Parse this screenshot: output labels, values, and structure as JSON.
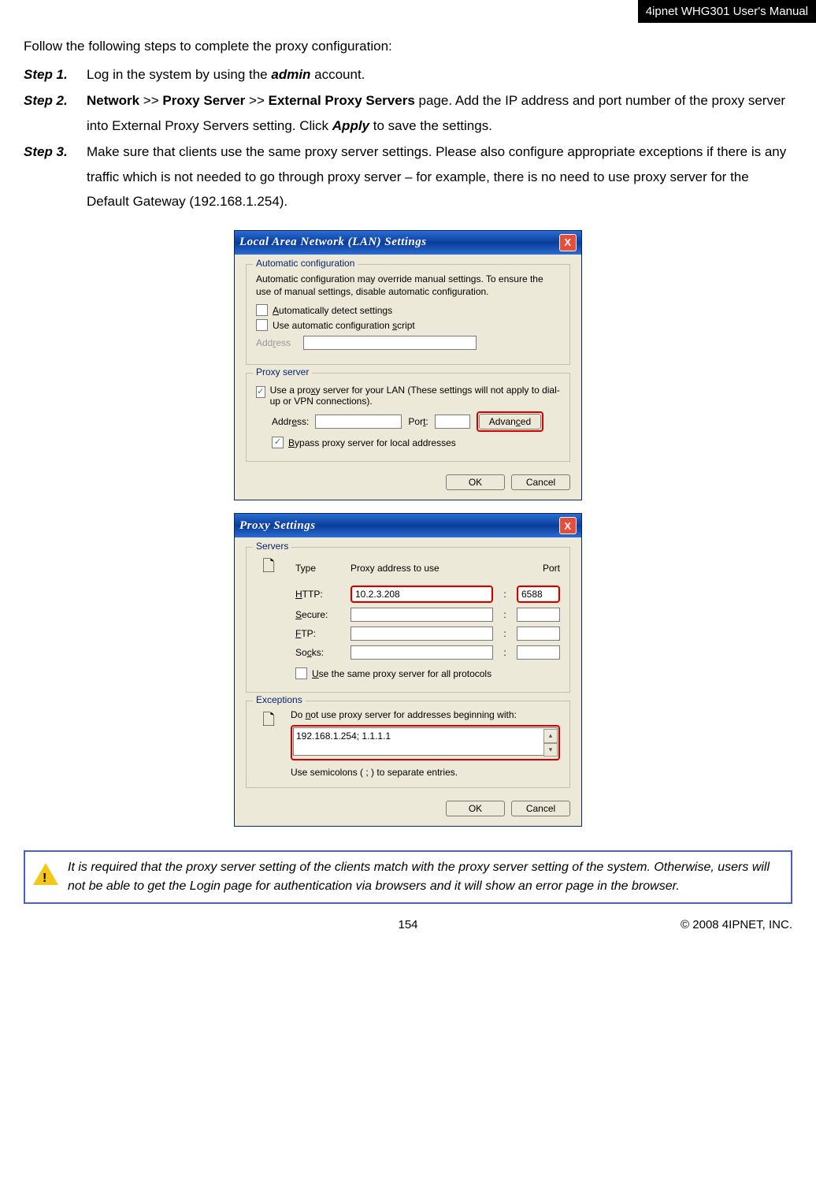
{
  "header": {
    "title": "4ipnet WHG301 User's Manual"
  },
  "intro": "Follow the following steps to complete the proxy configuration:",
  "steps": [
    {
      "label": "Step 1.",
      "pre": "Log in the system by using the ",
      "bold": "admin",
      "post": " account."
    },
    {
      "label": "Step 2.",
      "b1": "Network",
      "sep1": " >> ",
      "b2": "Proxy Server",
      "sep2": " >> ",
      "b3": "External Proxy Servers",
      "post1": " page. Add the IP address and port number of the proxy server into External Proxy Servers setting. Click ",
      "bapply": "Apply",
      "post2": " to save the settings."
    },
    {
      "label": "Step 3.",
      "text": "Make sure that clients use the same proxy server settings. Please also configure appropriate exceptions if there is any traffic which is not needed to go through proxy server – for example, there is no need to use proxy server for the Default Gateway (192.168.1.254)."
    }
  ],
  "dialog1": {
    "title": "Local Area Network (LAN) Settings",
    "auto_legend": "Automatic configuration",
    "auto_desc": "Automatic configuration may override manual settings.  To ensure the use of manual settings, disable automatic configuration.",
    "cb_auto_detect_pre": "A",
    "cb_auto_detect_post": "utomatically detect settings",
    "cb_auto_script": "Use automatic configuration ",
    "cb_auto_script_ul": "s",
    "cb_auto_script_post": "cript",
    "addr_label_pre": "Add",
    "addr_label_ul": "r",
    "addr_label_post": "ess",
    "proxy_legend": "Proxy server",
    "cb_use_proxy_pre": "Use a pro",
    "cb_use_proxy_ul": "x",
    "cb_use_proxy_post": "y server for your LAN (These settings will not apply to dial-up or VPN connections).",
    "addr2_pre": "Addr",
    "addr2_ul": "e",
    "addr2_post": "ss:",
    "port_pre": "Por",
    "port_ul": "t",
    "port_post": ":",
    "adv_pre": "Advan",
    "adv_ul": "c",
    "adv_post": "ed",
    "cb_bypass_ul": "B",
    "cb_bypass_post": "ypass proxy server for local addresses",
    "ok": "OK",
    "cancel": "Cancel"
  },
  "dialog2": {
    "title": "Proxy Settings",
    "servers_legend": "Servers",
    "type": "Type",
    "proxy_addr": "Proxy address to use",
    "port": "Port",
    "http_ul": "H",
    "http_post": "TTP:",
    "secure_ul": "S",
    "secure_post": "ecure:",
    "ftp_ul": "F",
    "ftp_post": "TP:",
    "socks_pre": "So",
    "socks_ul": "c",
    "socks_post": "ks:",
    "http_addr": "10.2.3.208",
    "http_port": "6588",
    "cb_same_ul": "U",
    "cb_same_post": "se the same proxy server for all protocols",
    "exc_legend": "Exceptions",
    "donot_pre": "Do ",
    "donot_ul": "n",
    "donot_post": "ot use proxy server for addresses beginning with:",
    "ta_value": "192.168.1.254; 1.1.1.1",
    "semi": "Use semicolons ( ; ) to separate entries.",
    "ok": "OK",
    "cancel": "Cancel"
  },
  "note": "It is required that the proxy server setting of the clients match with the proxy server setting of the system. Otherwise, users will not be able to get the Login page for authentication via browsers and it will show an error page in the browser.",
  "footer": {
    "page": "154",
    "copyright": "© 2008 4IPNET, INC."
  }
}
